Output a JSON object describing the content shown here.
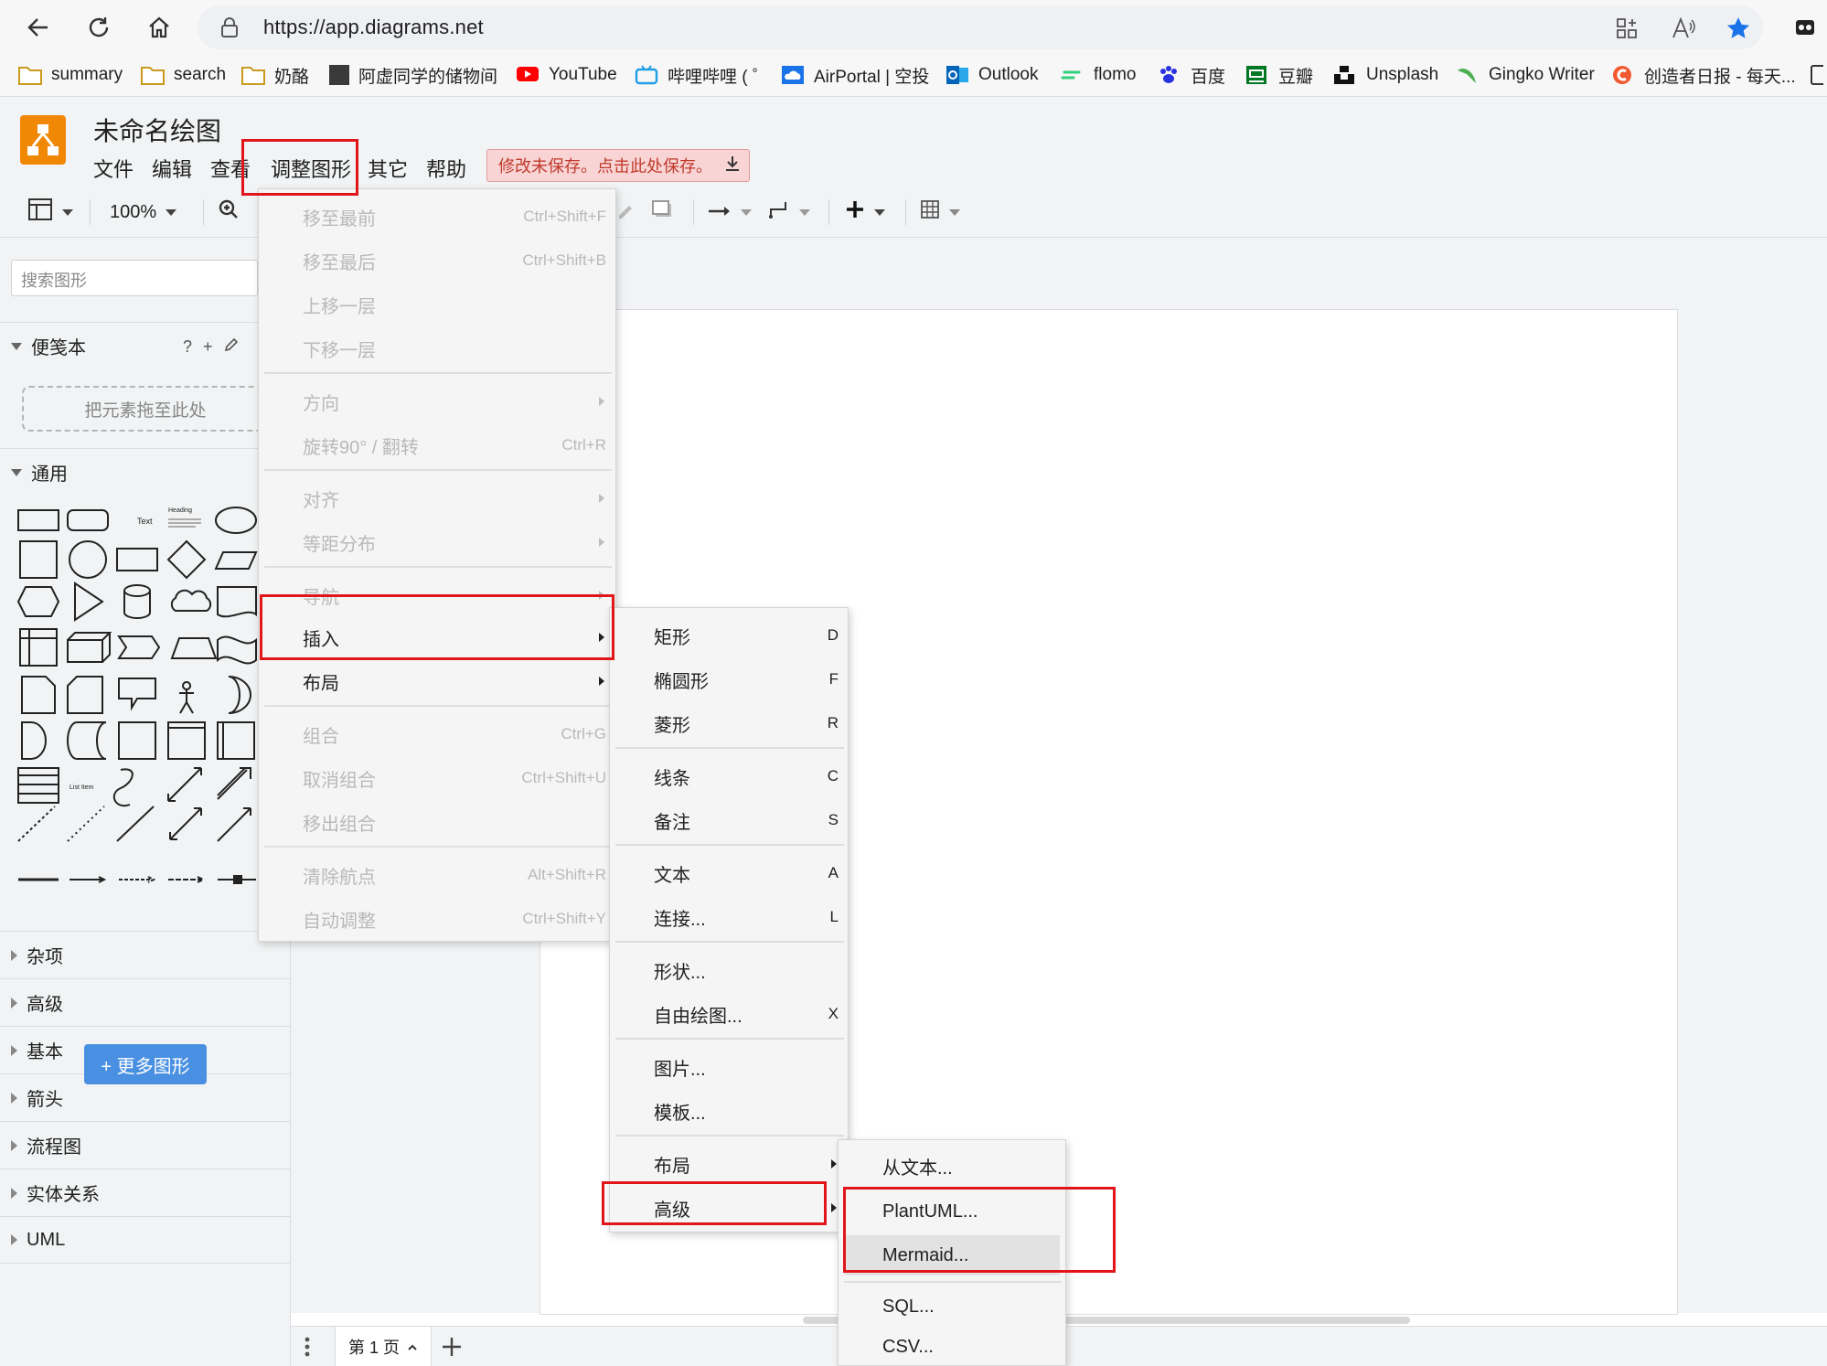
{
  "browser": {
    "url": "https://app.diagrams.net",
    "bookmarks": [
      "summary",
      "search",
      "奶酪",
      "阿虚同学的储物间",
      "YouTube",
      "哔哩哔哩 ( ゜",
      "AirPortal | 空投",
      "Outlook",
      "flomo",
      "百度",
      "豆瓣",
      "Unsplash",
      "Gingko Writer",
      "创造者日报 - 每天..."
    ]
  },
  "app": {
    "title": "未命名绘图",
    "menu": [
      "文件",
      "编辑",
      "查看",
      "调整图形",
      "其它",
      "帮助"
    ],
    "unsaved_notice": "修改未保存。点击此处保存。"
  },
  "toolbar": {
    "zoom": "100%"
  },
  "sidebar": {
    "search_placeholder": "搜索图形",
    "scratchpad": {
      "title": "便笺本",
      "help": "?",
      "add": "+",
      "dropzone": "把元素拖至此处"
    },
    "general_title": "通用",
    "shape_labels": {
      "text": "Text",
      "heading": "Heading",
      "list_item": "List Item"
    },
    "categories": [
      "杂项",
      "高级",
      "基本",
      "箭头",
      "流程图",
      "实体关系",
      "UML"
    ],
    "more_shapes": "+ 更多图形"
  },
  "pages": {
    "current": "第 1 页"
  },
  "arrange_menu": {
    "items": [
      {
        "label": "移至最前",
        "shortcut": "Ctrl+Shift+F"
      },
      {
        "label": "移至最后",
        "shortcut": "Ctrl+Shift+B"
      },
      {
        "label": "上移一层",
        "shortcut": ""
      },
      {
        "label": "下移一层",
        "shortcut": ""
      },
      {
        "label": "方向",
        "shortcut": ""
      },
      {
        "label": "旋转90° / 翻转",
        "shortcut": "Ctrl+R"
      },
      {
        "label": "对齐",
        "shortcut": ""
      },
      {
        "label": "等距分布",
        "shortcut": ""
      },
      {
        "label": "导航",
        "shortcut": ""
      },
      {
        "label": "插入",
        "shortcut": ""
      },
      {
        "label": "布局",
        "shortcut": ""
      },
      {
        "label": "组合",
        "shortcut": "Ctrl+G"
      },
      {
        "label": "取消组合",
        "shortcut": "Ctrl+Shift+U"
      },
      {
        "label": "移出组合",
        "shortcut": ""
      },
      {
        "label": "清除航点",
        "shortcut": "Alt+Shift+R"
      },
      {
        "label": "自动调整",
        "shortcut": "Ctrl+Shift+Y"
      }
    ]
  },
  "insert_menu": {
    "items": [
      {
        "label": "矩形",
        "shortcut": "D"
      },
      {
        "label": "椭圆形",
        "shortcut": "F"
      },
      {
        "label": "菱形",
        "shortcut": "R"
      },
      {
        "label": "线条",
        "shortcut": "C"
      },
      {
        "label": "备注",
        "shortcut": "S"
      },
      {
        "label": "文本",
        "shortcut": "A"
      },
      {
        "label": "连接...",
        "shortcut": "L"
      },
      {
        "label": "形状...",
        "shortcut": ""
      },
      {
        "label": "自由绘图...",
        "shortcut": "X"
      },
      {
        "label": "图片...",
        "shortcut": ""
      },
      {
        "label": "模板...",
        "shortcut": ""
      },
      {
        "label": "布局",
        "shortcut": ""
      },
      {
        "label": "高级",
        "shortcut": ""
      }
    ]
  },
  "advanced_menu": {
    "items": [
      "从文本...",
      "PlantUML...",
      "Mermaid...",
      "SQL...",
      "CSV..."
    ]
  },
  "colors": {
    "highlight": "#e0161b",
    "brand": "#f08705",
    "primary_button": "#4a90e2"
  }
}
